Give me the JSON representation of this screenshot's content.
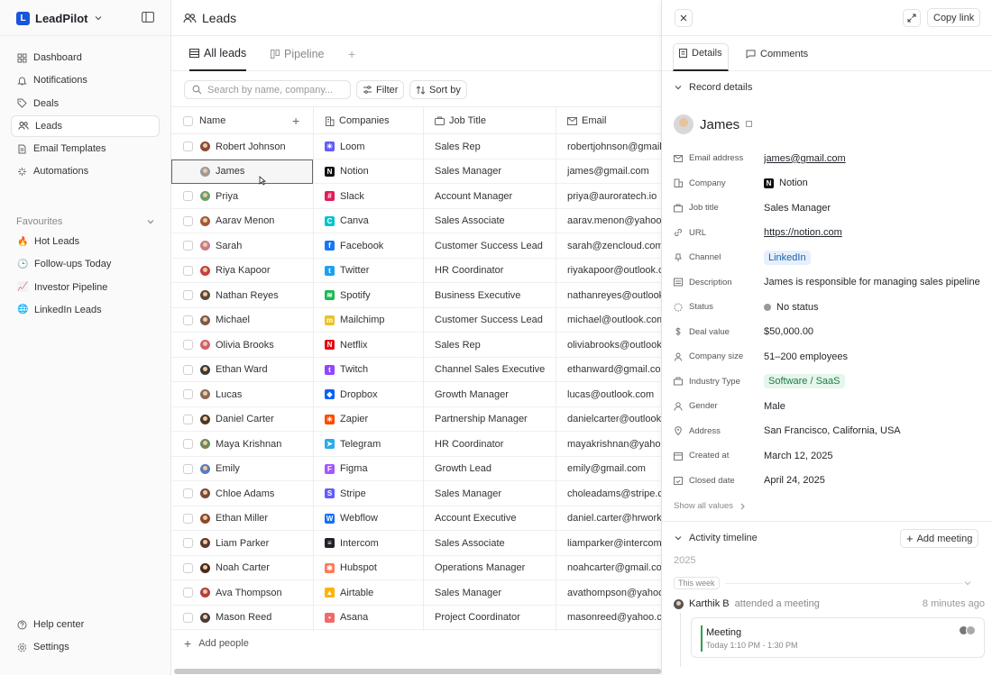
{
  "app": {
    "name": "LeadPilot",
    "logo_letter": "L"
  },
  "sidebar": {
    "nav": [
      {
        "label": "Dashboard",
        "icon": "grid-icon"
      },
      {
        "label": "Notifications",
        "icon": "bell-icon"
      },
      {
        "label": "Deals",
        "icon": "tag-icon"
      },
      {
        "label": "Leads",
        "icon": "users-icon",
        "active": true
      },
      {
        "label": "Email Templates",
        "icon": "file-icon"
      },
      {
        "label": "Automations",
        "icon": "sparkle-icon"
      }
    ],
    "favourites_title": "Favourites",
    "favourites": [
      {
        "label": "Hot Leads",
        "emoji": "🔥"
      },
      {
        "label": "Follow-ups Today",
        "emoji": "🕒"
      },
      {
        "label": "Investor Pipeline",
        "emoji": "📈"
      },
      {
        "label": "LinkedIn Leads",
        "emoji": "🌐"
      }
    ],
    "bottom": [
      {
        "label": "Help center",
        "icon": "help-icon"
      },
      {
        "label": "Settings",
        "icon": "settings-icon"
      }
    ]
  },
  "main": {
    "title": "Leads",
    "tabs": [
      {
        "label": "All leads",
        "active": true
      },
      {
        "label": "Pipeline",
        "active": false
      }
    ],
    "search_placeholder": "Search by name, company...",
    "filter_label": "Filter",
    "sort_label": "Sort by",
    "columns": [
      "Name",
      "Companies",
      "Job Title",
      "Email"
    ],
    "rows": [
      {
        "name": "Robert Johnson",
        "company": "Loom",
        "title": "Sales Rep",
        "email": "robertjohnson@gmail.com",
        "logo": "#625df5",
        "glyph": "✳",
        "av": "#8a4b3a"
      },
      {
        "name": "James",
        "company": "Notion",
        "title": "Sales Manager",
        "email": "james@gmail.com",
        "logo": "#111111",
        "glyph": "N",
        "av": "#9a9a9a",
        "selected": true
      },
      {
        "name": "Priya",
        "company": "Slack",
        "title": "Account Manager",
        "email": "priya@auroratech.io",
        "logo": "#e01e5a",
        "glyph": "#",
        "av": "#6aa06a"
      },
      {
        "name": "Aarav Menon",
        "company": "Canva",
        "title": "Sales Associate",
        "email": "aarav.menon@yahoo.com",
        "logo": "#00c4cc",
        "glyph": "C",
        "av": "#a05a3a"
      },
      {
        "name": "Sarah",
        "company": "Facebook",
        "title": "Customer Success Lead",
        "email": "sarah@zencloud.com",
        "logo": "#1877f2",
        "glyph": "f",
        "av": "#c97a8a"
      },
      {
        "name": "Riya Kapoor",
        "company": "Twitter",
        "title": "HR Coordinator",
        "email": "riyakapoor@outlook.com",
        "logo": "#1da1f2",
        "glyph": "t",
        "av": "#c94040"
      },
      {
        "name": "Nathan Reyes",
        "company": "Spotify",
        "title": "Business Executive",
        "email": "nathanreyes@outlook.com",
        "logo": "#1db954",
        "glyph": "≋",
        "av": "#5a4a3a"
      },
      {
        "name": "Michael",
        "company": "Mailchimp",
        "title": "Customer Success Lead",
        "email": "michael@outlook.com",
        "logo": "#e8c22a",
        "glyph": "m",
        "av": "#7a5a4a"
      },
      {
        "name": "Olivia Brooks",
        "company": "Netflix",
        "title": "Sales Rep",
        "email": "oliviabrooks@outlook.com",
        "logo": "#e50914",
        "glyph": "N",
        "av": "#d06070"
      },
      {
        "name": "Ethan Ward",
        "company": "Twitch",
        "title": "Channel Sales Executive",
        "email": "ethanward@gmail.com",
        "logo": "#9146ff",
        "glyph": "t",
        "av": "#3a3a3a"
      },
      {
        "name": "Lucas",
        "company": "Dropbox",
        "title": "Growth Manager",
        "email": "lucas@outlook.com",
        "logo": "#0061ff",
        "glyph": "◆",
        "av": "#8a6a5a"
      },
      {
        "name": "Daniel Carter",
        "company": "Zapier",
        "title": "Partnership Manager",
        "email": "danielcarter@outlook.com",
        "logo": "#ff4a00",
        "glyph": "✳",
        "av": "#4a3a2a"
      },
      {
        "name": "Maya Krishnan",
        "company": "Telegram",
        "title": "HR Coordinator",
        "email": "mayakrishnan@yahoo.com",
        "logo": "#2aabee",
        "glyph": "➤",
        "av": "#6a8a5a"
      },
      {
        "name": "Emily",
        "company": "Figma",
        "title": "Growth Lead",
        "email": "emily@gmail.com",
        "logo": "#a259ff",
        "glyph": "F",
        "av": "#5a7ac0"
      },
      {
        "name": "Chloe Adams",
        "company": "Stripe",
        "title": "Sales Manager",
        "email": "choleadams@stripe.com",
        "logo": "#635bff",
        "glyph": "S",
        "av": "#7a4a3a"
      },
      {
        "name": "Ethan Miller",
        "company": "Webflow",
        "title": "Account Executive",
        "email": "daniel.carter@hrworks.io",
        "logo": "#146ef5",
        "glyph": "W",
        "av": "#8a4a2a"
      },
      {
        "name": "Liam Parker",
        "company": "Intercom",
        "title": "Sales Associate",
        "email": "liamparker@intercom.com",
        "logo": "#1f2328",
        "glyph": "≡",
        "av": "#5a3a2a"
      },
      {
        "name": "Noah Carter",
        "company": "Hubspot",
        "title": "Operations Manager",
        "email": "noahcarter@gmail.com",
        "logo": "#ff7a59",
        "glyph": "✱",
        "av": "#4a2a1a"
      },
      {
        "name": "Ava Thompson",
        "company": "Airtable",
        "title": "Sales Manager",
        "email": "avathompson@yahoo.com",
        "logo": "#fcb400",
        "glyph": "▲",
        "av": "#b04040"
      },
      {
        "name": "Mason Reed",
        "company": "Asana",
        "title": "Project Coordinator",
        "email": "masonreed@yahoo.com",
        "logo": "#f06a6a",
        "glyph": "•",
        "av": "#4a3a3a"
      }
    ],
    "add_people": "Add people"
  },
  "panel": {
    "copy_link": "Copy link",
    "tabs": {
      "details": "Details",
      "comments": "Comments"
    },
    "record_section": "Record details",
    "record_name": "James",
    "fields": [
      {
        "label": "Email address",
        "value": "james@gmail.com",
        "kind": "link",
        "icon": "mail-icon"
      },
      {
        "label": "Company",
        "value": "Notion",
        "kind": "company",
        "icon": "building-icon"
      },
      {
        "label": "Job title",
        "value": "Sales Manager",
        "kind": "text",
        "icon": "briefcase-icon"
      },
      {
        "label": "URL",
        "value": "https://notion.com",
        "kind": "link",
        "icon": "link-icon"
      },
      {
        "label": "Channel",
        "value": "LinkedIn",
        "kind": "chip-blue",
        "icon": "pin-icon"
      },
      {
        "label": "Description",
        "value": "James is responsible for managing sales pipelines",
        "kind": "text",
        "icon": "description-icon"
      },
      {
        "label": "Status",
        "value": "No status",
        "kind": "status",
        "icon": "status-icon"
      },
      {
        "label": "Deal value",
        "value": "$50,000.00",
        "kind": "text",
        "icon": "dollar-icon"
      },
      {
        "label": "Company size",
        "value": "51–200 employees",
        "kind": "text",
        "icon": "people-icon"
      },
      {
        "label": "Industry Type",
        "value": "Software / SaaS",
        "kind": "chip-green",
        "icon": "industry-icon"
      },
      {
        "label": "Gender",
        "value": "Male",
        "kind": "text",
        "icon": "person-icon"
      },
      {
        "label": "Address",
        "value": "San Francisco, California, USA",
        "kind": "text",
        "icon": "location-icon"
      },
      {
        "label": "Created at",
        "value": "March 12, 2025",
        "kind": "text",
        "icon": "calendar-icon"
      },
      {
        "label": "Closed date",
        "value": "April 24, 2025",
        "kind": "text",
        "icon": "calendar-check-icon"
      }
    ],
    "show_all": "Show all values",
    "activity_section": "Activity timeline",
    "add_meeting": "Add meeting",
    "year": "2025",
    "week_label": "This week",
    "activity": {
      "user": "Karthik B",
      "action": "attended a meeting",
      "when": "8 minutes ago"
    },
    "meeting": {
      "title": "Meeting",
      "time": "Today 1:10 PM - 1:30 PM"
    }
  }
}
